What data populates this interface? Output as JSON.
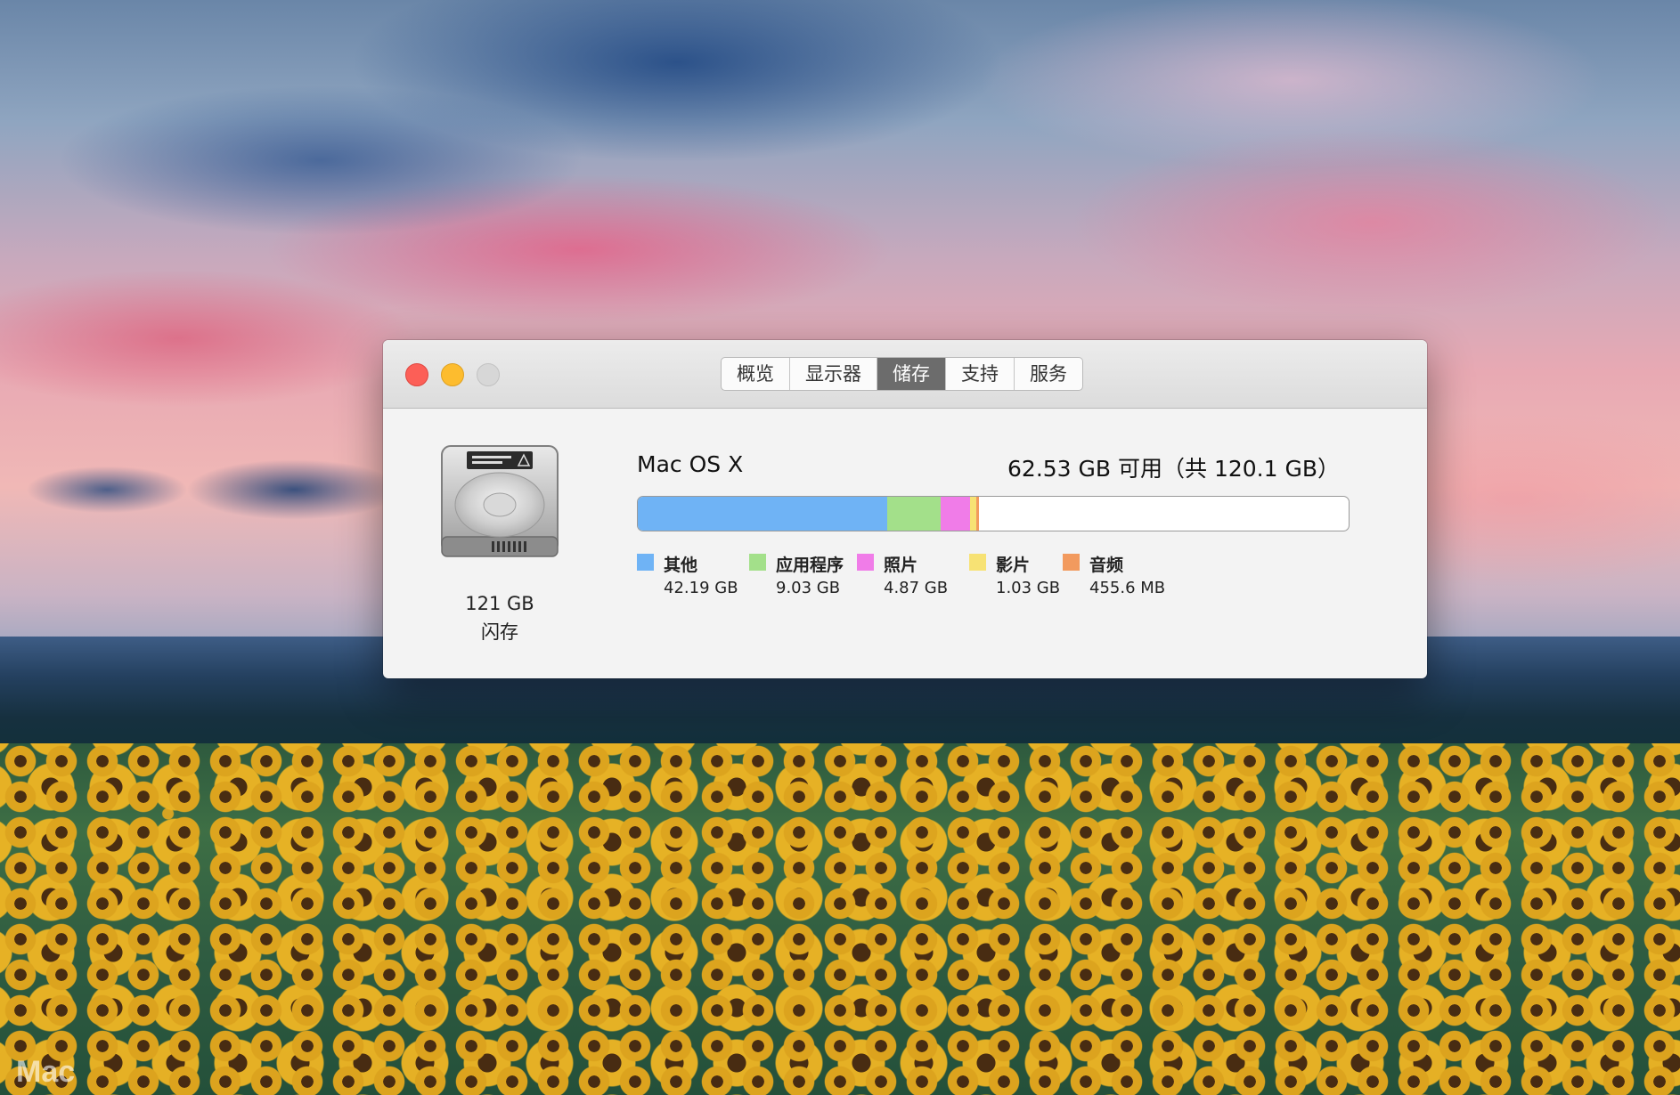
{
  "window": {
    "tabs": [
      {
        "label": "概览",
        "active": false
      },
      {
        "label": "显示器",
        "active": false
      },
      {
        "label": "储存",
        "active": true
      },
      {
        "label": "支持",
        "active": false
      },
      {
        "label": "服务",
        "active": false
      }
    ]
  },
  "disk": {
    "size": "121 GB",
    "type": "闪存",
    "icon": "hard-drive-icon"
  },
  "volume": {
    "name": "Mac OS X",
    "capacity": "62.53 GB 可用（共 120.1 GB）",
    "total_gb": 120.1
  },
  "storage": {
    "categories": [
      {
        "label": "其他",
        "value": "42.19 GB",
        "gb": 42.19,
        "color": "#6fb3f5"
      },
      {
        "label": "应用程序",
        "value": "9.03 GB",
        "gb": 9.03,
        "color": "#a3e08a"
      },
      {
        "label": "照片",
        "value": "4.87 GB",
        "gb": 4.87,
        "color": "#f07ce8"
      },
      {
        "label": "影片",
        "value": "1.03 GB",
        "gb": 1.03,
        "color": "#f7e274"
      },
      {
        "label": "音频",
        "value": "455.6 MB",
        "gb": 0.4556,
        "color": "#f29a5e"
      }
    ]
  },
  "wallpaper": {
    "watermark": "Mac"
  }
}
